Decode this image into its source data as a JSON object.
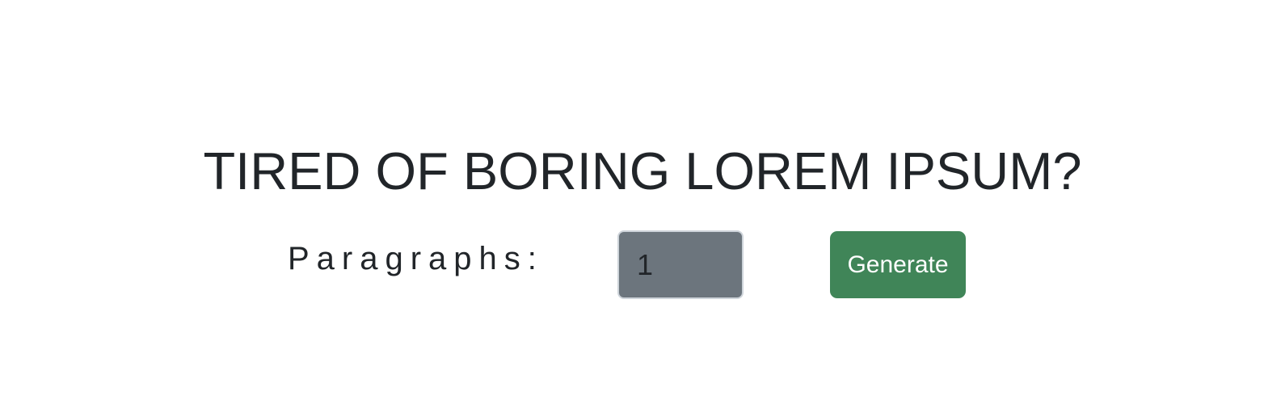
{
  "hero": {
    "title": "TIRED OF BORING LOREM IPSUM?"
  },
  "form": {
    "paragraphs_label": "Paragraphs:",
    "paragraphs_value": "1",
    "generate_label": "Generate"
  },
  "colors": {
    "text": "#212529",
    "input_background": "#6c757d",
    "input_border": "#ced4da",
    "button_background": "#408558",
    "button_text": "#ffffff"
  }
}
